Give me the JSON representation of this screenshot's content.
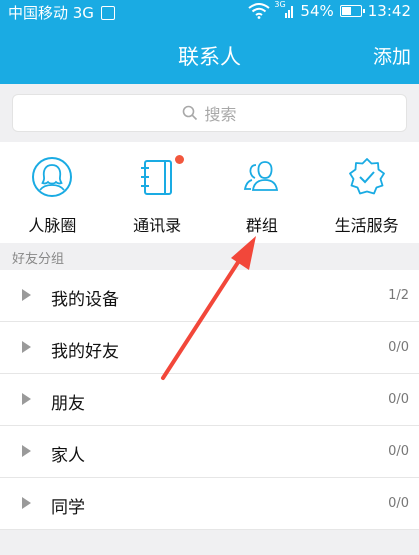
{
  "status_bar": {
    "carrier": "中国移动 3G",
    "signal_label": "3G",
    "battery_text": "54%",
    "battery_level": 0.54,
    "time": "13:42"
  },
  "header": {
    "title": "联系人",
    "add_label": "添加"
  },
  "search": {
    "placeholder": "搜索"
  },
  "shortcuts": [
    {
      "label": "人脉圈",
      "icon": "person-circle-icon"
    },
    {
      "label": "通讯录",
      "icon": "address-book-icon",
      "has_badge": true
    },
    {
      "label": "群组",
      "icon": "group-icon"
    },
    {
      "label": "生活服务",
      "icon": "verified-badge-icon"
    }
  ],
  "section": {
    "title": "好友分组"
  },
  "groups": [
    {
      "name": "我的设备",
      "count": "1/2"
    },
    {
      "name": "我的好友",
      "count": "0/0"
    },
    {
      "name": "朋友",
      "count": "0/0"
    },
    {
      "name": "家人",
      "count": "0/0"
    },
    {
      "name": "同学",
      "count": "0/0"
    }
  ],
  "colors": {
    "accent": "#1aabe3",
    "badge": "#f2573d",
    "annotation_arrow": "#f2473a"
  }
}
